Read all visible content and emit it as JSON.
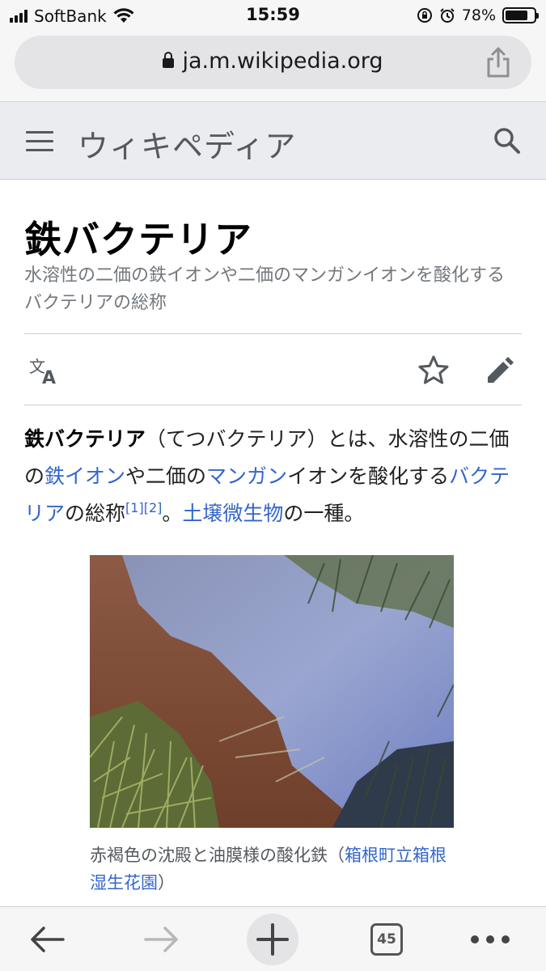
{
  "status_bar": {
    "carrier": "SoftBank",
    "time": "15:59",
    "battery_percent": "78%",
    "battery_level": 0.78
  },
  "browser": {
    "url": "ja.m.wikipedia.org",
    "tab_count": "45"
  },
  "wiki": {
    "wordmark": "ウィキペディア"
  },
  "article": {
    "title": "鉄バクテリア",
    "description": "水溶性の二価の鉄イオンや二価のマンガンイオンを酸化するバクテリアの総称",
    "lead": {
      "bold_term": "鉄バクテリア",
      "t1": "（てつバクテリア）とは、水溶性の二価の",
      "link_iron_ion": "鉄イオン",
      "t2": "や二価の",
      "link_manganese": "マンガン",
      "t3": "イオンを酸化する",
      "link_bacteria": "バクテリア",
      "t4": "の総称",
      "ref1": "[1]",
      "ref2": "[2]",
      "t5": "。",
      "link_soil_microbe": "土壌微生物",
      "t6": "の一種。"
    },
    "figure_caption": {
      "text": "赤褐色の沈殿と油膜様の酸化鉄（",
      "link": "箱根町立箱根湿生花園",
      "close": "）"
    }
  },
  "colors": {
    "link": "#3366cc",
    "header_bg": "#eaecf0",
    "muted_text": "#72777d"
  }
}
